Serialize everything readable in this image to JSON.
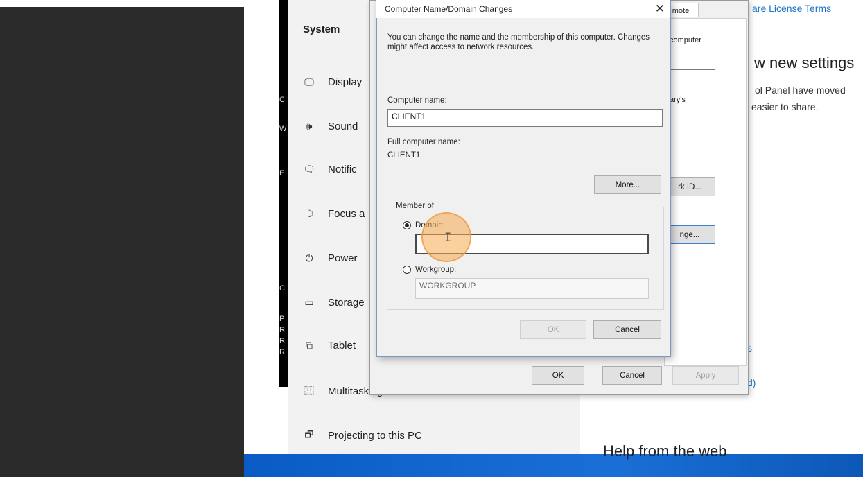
{
  "settings": {
    "sidebar_title": "System",
    "nav_items": [
      {
        "icon": "display-icon",
        "glyph": "🖵",
        "label": "Display"
      },
      {
        "icon": "sound-icon",
        "glyph": "🕪",
        "label": "Sound"
      },
      {
        "icon": "notifications-icon",
        "glyph": "🗨",
        "label": "Notific"
      },
      {
        "icon": "focus-assist-icon",
        "glyph": "☽",
        "label": "Focus a"
      },
      {
        "icon": "power-icon",
        "glyph": "⏻",
        "label": "Power"
      },
      {
        "icon": "storage-icon",
        "glyph": "▭",
        "label": "Storage"
      },
      {
        "icon": "tablet-icon",
        "glyph": "⧉",
        "label": "Tablet"
      },
      {
        "icon": "multitasking-icon",
        "glyph": "⿲",
        "label": "Multitasking"
      },
      {
        "icon": "projecting-icon",
        "glyph": "🗗",
        "label": "Projecting to this PC"
      }
    ],
    "right_pane": {
      "license_link": "are License Terms",
      "heading_partial": "w new settings",
      "text_line1": "ol Panel have moved",
      "text_line2": "easier to share.",
      "link_fragment_s": "s",
      "link_fragment_d": "d)",
      "help_heading": "Help from the web"
    },
    "bg_letters": [
      "C",
      "W",
      "E",
      "C",
      "P",
      "R",
      "R",
      "R"
    ]
  },
  "system_properties": {
    "tab_label": "mote",
    "computer_text": "computer",
    "ary_text": "ary's",
    "network_id_button": "rk ID...",
    "change_button": "nge...",
    "ok_button": "OK",
    "cancel_button": "Cancel",
    "apply_button": "Apply"
  },
  "name_dialog": {
    "title": "Computer Name/Domain Changes",
    "description": "You can change the name and the membership of this computer. Changes might affect access to network resources.",
    "computer_name_label": "Computer name:",
    "computer_name_value": "CLIENT1",
    "full_name_label": "Full computer name:",
    "full_name_value": "CLIENT1",
    "more_button": "More...",
    "member_of_label": "Member of",
    "domain_label": "Domain:",
    "domain_value": "",
    "workgroup_label": "Workgroup:",
    "workgroup_value": "WORKGROUP",
    "ok_button": "OK",
    "cancel_button": "Cancel",
    "selected_membership": "domain"
  },
  "colors": {
    "link": "#1a73c9",
    "cursor_highlight": "#f5aa50",
    "desktop": "#1a6fd6"
  }
}
